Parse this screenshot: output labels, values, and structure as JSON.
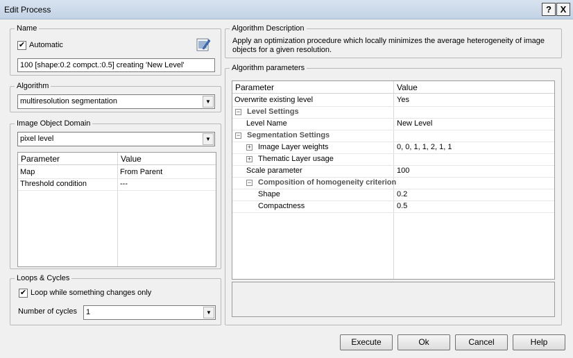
{
  "window": {
    "title": "Edit Process",
    "help_button": "?",
    "close_button": "X"
  },
  "name_group": {
    "label": "Name",
    "automatic_label": "Automatic",
    "automatic_checked": true,
    "name_value": "100 [shape:0.2 compct.:0.5] creating 'New Level'"
  },
  "algorithm_group": {
    "label": "Algorithm",
    "selected": "multiresolution segmentation"
  },
  "domain_group": {
    "label": "Image Object Domain",
    "selected": "pixel level",
    "columns": [
      "Parameter",
      "Value"
    ],
    "rows": [
      {
        "param": "Map",
        "value": "From Parent"
      },
      {
        "param": "Threshold condition",
        "value": "---"
      }
    ]
  },
  "loops_group": {
    "label": "Loops & Cycles",
    "loop_label": "Loop while something changes only",
    "loop_checked": true,
    "cycles_label": "Number of cycles",
    "cycles_value": "1"
  },
  "description_group": {
    "label": "Algorithm Description",
    "text": "Apply an optimization procedure which locally minimizes the average heterogeneity of image objects for a given resolution."
  },
  "params_group": {
    "label": "Algorithm parameters",
    "columns": [
      "Parameter",
      "Value"
    ],
    "rows": [
      {
        "param": "Overwrite existing level",
        "value": "Yes"
      },
      {
        "param": "Level Settings",
        "value": ""
      },
      {
        "param": "Level Name",
        "value": "New Level"
      },
      {
        "param": "Segmentation Settings",
        "value": ""
      },
      {
        "param": "Image Layer weights",
        "value": "0, 0, 1, 1, 2, 1, 1"
      },
      {
        "param": "Thematic Layer usage",
        "value": ""
      },
      {
        "param": "Scale parameter",
        "value": "100"
      },
      {
        "param": "Composition of homogeneity criterion",
        "value": ""
      },
      {
        "param": "Shape",
        "value": "0.2"
      },
      {
        "param": "Compactness",
        "value": "0.5"
      }
    ],
    "expander_symbols": {
      "collapse": "−",
      "expand": "+"
    }
  },
  "buttons": {
    "execute": "Execute",
    "ok": "Ok",
    "cancel": "Cancel",
    "help": "Help"
  },
  "icons": {
    "check": "✔",
    "dropdown": "▼",
    "edit": "edit-icon"
  }
}
